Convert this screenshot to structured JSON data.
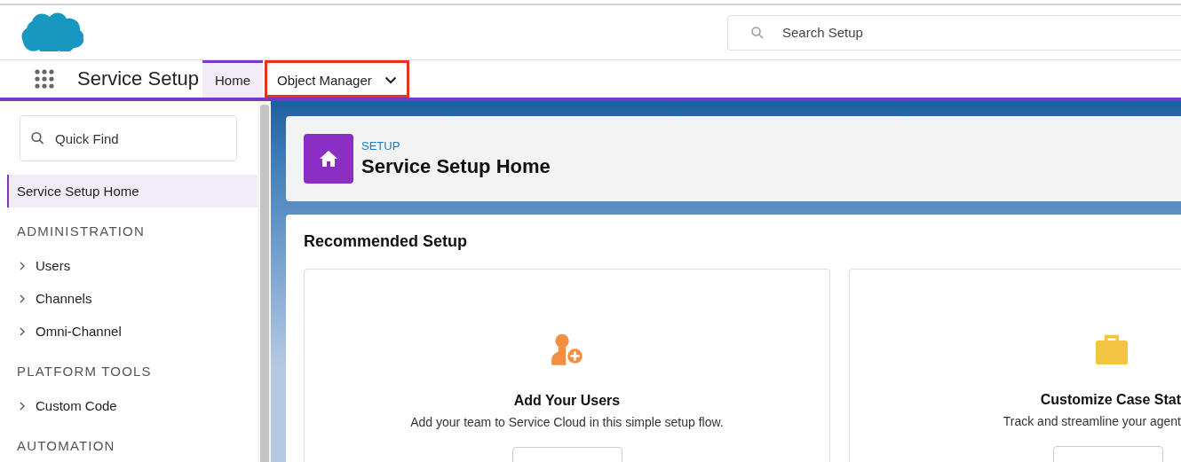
{
  "header": {
    "search": {
      "placeholder": "Search Setup"
    }
  },
  "nav": {
    "app_name": "Service Setup",
    "tabs": [
      {
        "label": "Home",
        "selected": true,
        "outlined": false,
        "dropdown": false
      },
      {
        "label": "Object Manager",
        "selected": false,
        "outlined": true,
        "dropdown": true
      }
    ]
  },
  "sidebar": {
    "quick_find": {
      "placeholder": "Quick Find"
    },
    "items": [
      {
        "kind": "link",
        "label": "Service Setup Home",
        "selected": true
      },
      {
        "kind": "section",
        "label": "ADMINISTRATION"
      },
      {
        "kind": "folder",
        "label": "Users",
        "selected": false,
        "expanded": false
      },
      {
        "kind": "folder",
        "label": "Channels",
        "selected": false,
        "expanded": false
      },
      {
        "kind": "folder",
        "label": "Omni-Channel",
        "selected": false,
        "expanded": false
      },
      {
        "kind": "section",
        "label": "PLATFORM TOOLS"
      },
      {
        "kind": "folder",
        "label": "Custom Code",
        "selected": false,
        "expanded": false
      },
      {
        "kind": "section",
        "label": "AUTOMATION"
      }
    ]
  },
  "page_header": {
    "eyebrow": "SETUP",
    "title": "Service Setup Home"
  },
  "recommended": {
    "title": "Recommended Setup",
    "cards": [
      {
        "kind": "users",
        "title": "Add Your Users",
        "description": "Add your team to Service Cloud in this simple setup flow."
      },
      {
        "kind": "case",
        "title": "Customize Case Stat",
        "description": "Track and streamline your agent"
      }
    ]
  }
}
